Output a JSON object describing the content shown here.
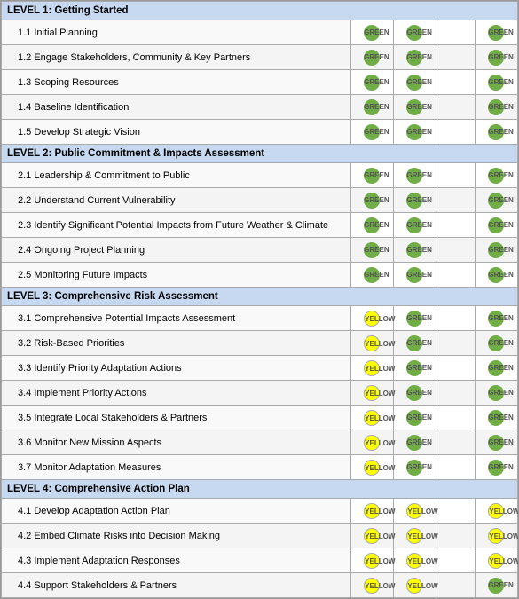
{
  "levels": [
    {
      "id": "level1",
      "header": "LEVEL 1:  Getting Started",
      "items": [
        {
          "id": "1.1",
          "label": "1.1 Initial Planning",
          "dots": [
            "green",
            "green",
            "",
            "green"
          ]
        },
        {
          "id": "1.2",
          "label": "1.2 Engage Stakeholders, Community & Key Partners",
          "dots": [
            "green",
            "green",
            "",
            "green"
          ]
        },
        {
          "id": "1.3",
          "label": "1.3 Scoping Resources",
          "dots": [
            "green",
            "green",
            "",
            "green"
          ]
        },
        {
          "id": "1.4",
          "label": "1.4 Baseline Identification",
          "dots": [
            "green",
            "green",
            "",
            "green"
          ]
        },
        {
          "id": "1.5",
          "label": "1.5 Develop Strategic Vision",
          "dots": [
            "green",
            "green",
            "",
            "green"
          ]
        }
      ]
    },
    {
      "id": "level2",
      "header": "LEVEL 2:  Public Commitment & Impacts Assessment",
      "items": [
        {
          "id": "2.1",
          "label": "2.1 Leadership & Commitment to Public",
          "dots": [
            "green",
            "green",
            "",
            "green"
          ]
        },
        {
          "id": "2.2",
          "label": "2.2 Understand Current Vulnerability",
          "dots": [
            "green",
            "green",
            "",
            "green"
          ]
        },
        {
          "id": "2.3",
          "label": "2.3 Identify Significant Potential Impacts from Future Weather & Climate",
          "dots": [
            "green",
            "green",
            "",
            "green"
          ]
        },
        {
          "id": "2.4",
          "label": "2.4 Ongoing Project Planning",
          "dots": [
            "green",
            "green",
            "",
            "green"
          ]
        },
        {
          "id": "2.5",
          "label": "2.5 Monitoring Future Impacts",
          "dots": [
            "green",
            "green",
            "",
            "green"
          ]
        }
      ]
    },
    {
      "id": "level3",
      "header": "LEVEL 3:  Comprehensive Risk Assessment",
      "items": [
        {
          "id": "3.1",
          "label": "3.1 Comprehensive Potential Impacts Assessment",
          "dots": [
            "yellow",
            "green",
            "",
            "green"
          ]
        },
        {
          "id": "3.2",
          "label": "3.2 Risk-Based Priorities",
          "dots": [
            "yellow",
            "green",
            "",
            "green"
          ]
        },
        {
          "id": "3.3",
          "label": "3.3 Identify Priority Adaptation Actions",
          "dots": [
            "yellow",
            "green",
            "",
            "green"
          ]
        },
        {
          "id": "3.4",
          "label": "3.4 Implement Priority Actions",
          "dots": [
            "yellow",
            "green",
            "",
            "green"
          ]
        },
        {
          "id": "3.5",
          "label": "3.5 Integrate Local Stakeholders & Partners",
          "dots": [
            "yellow",
            "green",
            "",
            "green"
          ]
        },
        {
          "id": "3.6",
          "label": "3.6 Monitor New Mission Aspects",
          "dots": [
            "yellow",
            "green",
            "",
            "green"
          ]
        },
        {
          "id": "3.7",
          "label": "3.7 Monitor Adaptation Measures",
          "dots": [
            "yellow",
            "green",
            "",
            "green"
          ]
        }
      ]
    },
    {
      "id": "level4",
      "header": "LEVEL 4:  Comprehensive Action Plan",
      "items": [
        {
          "id": "4.1",
          "label": "4.1 Develop Adaptation Action Plan",
          "dots": [
            "yellow",
            "yellow",
            "",
            "yellow"
          ]
        },
        {
          "id": "4.2",
          "label": "4.2 Embed Climate Risks into Decision Making",
          "dots": [
            "yellow",
            "yellow",
            "",
            "yellow"
          ]
        },
        {
          "id": "4.3",
          "label": "4.3 Implement Adaptation Responses",
          "dots": [
            "yellow",
            "yellow",
            "",
            "yellow"
          ]
        },
        {
          "id": "4.4",
          "label": "4.4 Support Stakeholders & Partners",
          "dots": [
            "yellow",
            "yellow",
            "",
            "green"
          ]
        }
      ]
    }
  ]
}
